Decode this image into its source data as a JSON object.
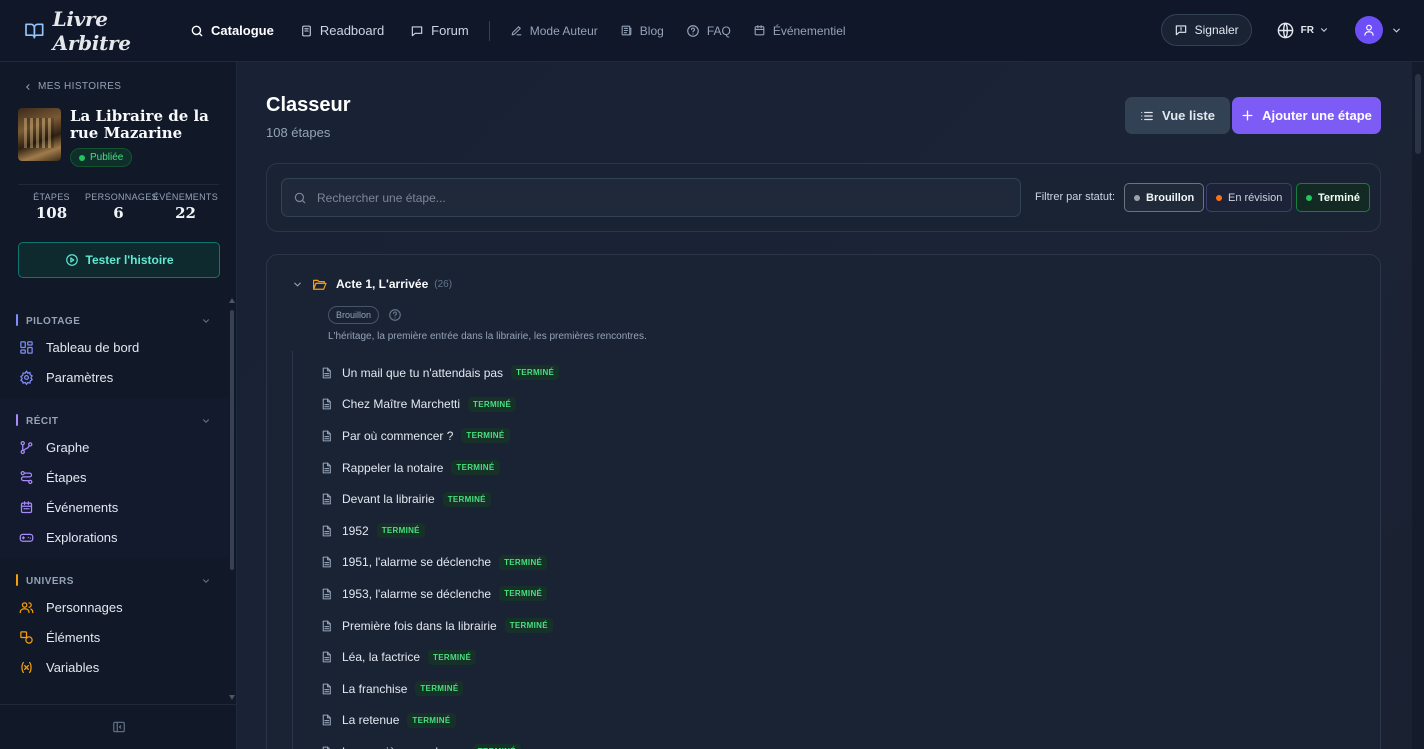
{
  "app": {
    "logo_text": "Livre Arbitre"
  },
  "nav": {
    "catalogue": "Catalogue",
    "readboard": "Readboard",
    "forum": "Forum",
    "mode_auteur": "Mode Auteur",
    "blog": "Blog",
    "faq": "FAQ",
    "evenementiel": "Événementiel"
  },
  "topbar": {
    "report_label": "Signaler",
    "language": "FR"
  },
  "sidebar": {
    "back_label": "MES HISTOIRES",
    "story_title": "La Libraire de la rue Mazarine",
    "story_status": "Publiée",
    "stats": [
      {
        "label": "ÉTAPES",
        "value": "108"
      },
      {
        "label": "PERSONNAGES",
        "value": "6"
      },
      {
        "label": "ÉVÉNEMENTS",
        "value": "22"
      }
    ],
    "test_label": "Tester l'histoire",
    "sections": [
      {
        "title": "PILOTAGE",
        "color": "#818cf8",
        "items": [
          {
            "label": "Tableau de bord",
            "icon": "dashboard-icon"
          },
          {
            "label": "Paramètres",
            "icon": "gear-icon"
          }
        ]
      },
      {
        "title": "RÉCIT",
        "color": "#a78bfa",
        "items": [
          {
            "label": "Graphe",
            "icon": "graph-icon"
          },
          {
            "label": "Étapes",
            "icon": "steps-icon"
          },
          {
            "label": "Événements",
            "icon": "calendar-icon"
          },
          {
            "label": "Explorations",
            "icon": "gamepad-icon"
          }
        ]
      },
      {
        "title": "UNIVERS",
        "color": "#f59e0b",
        "items": [
          {
            "label": "Personnages",
            "icon": "users-icon"
          },
          {
            "label": "Éléments",
            "icon": "shapes-icon"
          },
          {
            "label": "Variables",
            "icon": "variable-icon"
          }
        ]
      }
    ]
  },
  "main": {
    "title": "Classeur",
    "count": "108 étapes",
    "list_view_label": "Vue liste",
    "add_step_label": "Ajouter une étape",
    "search_placeholder": "Rechercher une étape...",
    "filter_label": "Filtrer par statut:",
    "filters": [
      {
        "label": "Brouillon",
        "color": "#9ca3af"
      },
      {
        "label": "En révision",
        "color": "#f97316"
      },
      {
        "label": "Terminé",
        "color": "#22c55e"
      }
    ]
  },
  "act": {
    "title": "Acte 1, L'arrivée",
    "count": "(26)",
    "status": "Brouillon",
    "description": "L'héritage, la première entrée dans la librairie, les premières rencontres.",
    "steps": [
      {
        "name": "Un mail que tu n'attendais pas",
        "status": "TERMINÉ"
      },
      {
        "name": "Chez Maître Marchetti",
        "status": "TERMINÉ"
      },
      {
        "name": "Par où commencer ?",
        "status": "TERMINÉ"
      },
      {
        "name": "Rappeler la notaire",
        "status": "TERMINÉ"
      },
      {
        "name": "Devant la librairie",
        "status": "TERMINÉ"
      },
      {
        "name": "1952",
        "status": "TERMINÉ"
      },
      {
        "name": "1951, l'alarme se déclenche",
        "status": "TERMINÉ"
      },
      {
        "name": "1953, l'alarme se déclenche",
        "status": "TERMINÉ"
      },
      {
        "name": "Première fois dans la librairie",
        "status": "TERMINÉ"
      },
      {
        "name": "Léa, la factrice",
        "status": "TERMINÉ"
      },
      {
        "name": "La franchise",
        "status": "TERMINÉ"
      },
      {
        "name": "La retenue",
        "status": "TERMINÉ"
      },
      {
        "name": "La première enveloppe",
        "status": "TERMINÉ"
      }
    ]
  }
}
